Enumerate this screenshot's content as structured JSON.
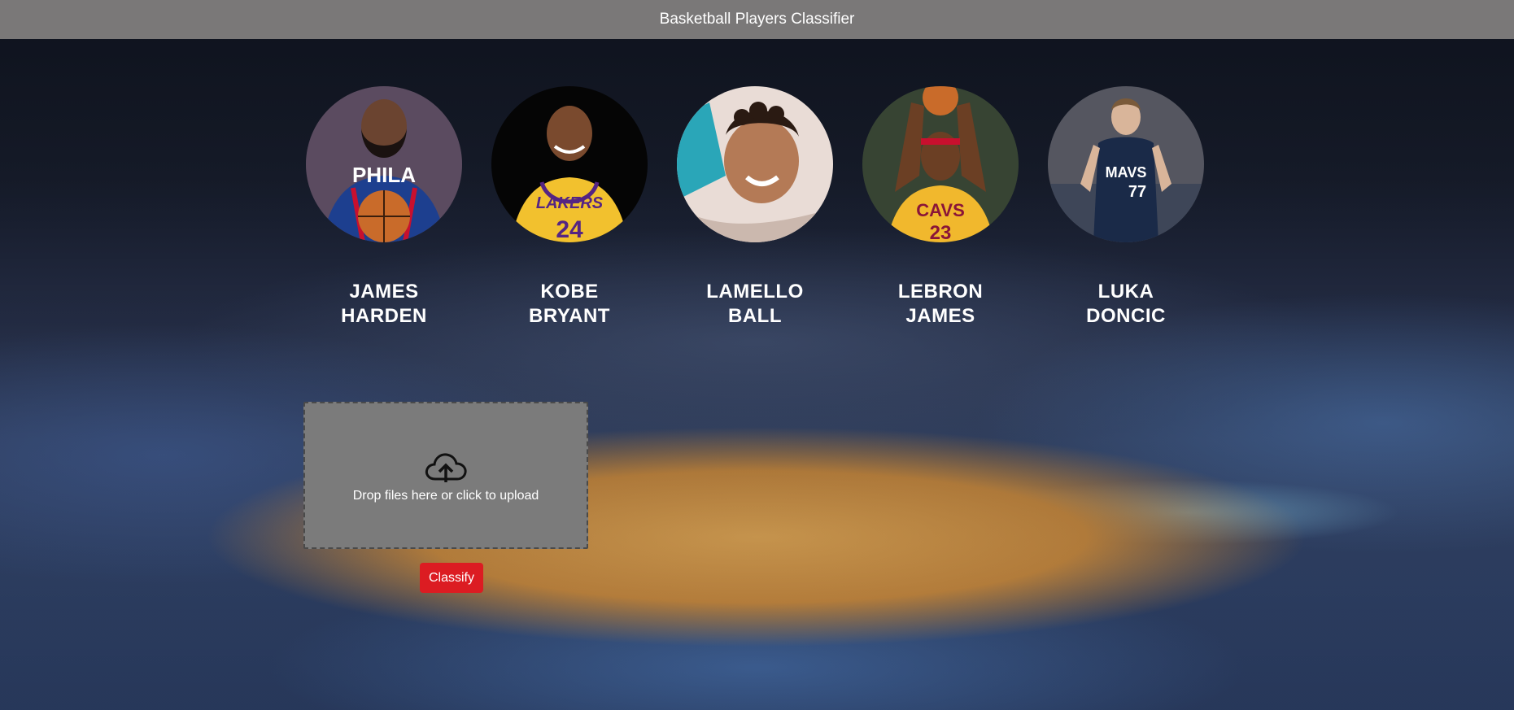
{
  "app": {
    "title": "Basketball Players Classifier"
  },
  "players": [
    {
      "name_line1": "JAMES",
      "name_line2": "HARDEN",
      "photo": "james-harden-photo",
      "jersey_color": "#1d3f8f",
      "jersey_text": "PHILA"
    },
    {
      "name_line1": "KOBE",
      "name_line2": "BRYANT",
      "photo": "kobe-bryant-photo",
      "jersey_color": "#f2c12e",
      "jersey_text": "LAKERS"
    },
    {
      "name_line1": "LAMELLO",
      "name_line2": "BALL",
      "photo": "lamelo-ball-photo",
      "jersey_color": "#2aa6b8",
      "jersey_text": ""
    },
    {
      "name_line1": "LEBRON",
      "name_line2": "JAMES",
      "photo": "lebron-james-photo",
      "jersey_color": "#f1b82d",
      "jersey_text": "CAVS"
    },
    {
      "name_line1": "LUKA",
      "name_line2": "DONCIC",
      "photo": "luka-doncic-photo",
      "jersey_color": "#1a2a48",
      "jersey_text": "MAVS"
    }
  ],
  "upload": {
    "icon": "cloud-upload-icon",
    "text": "Drop files here or click to upload"
  },
  "classify": {
    "label": "Classify",
    "color": "#dc1c22"
  }
}
